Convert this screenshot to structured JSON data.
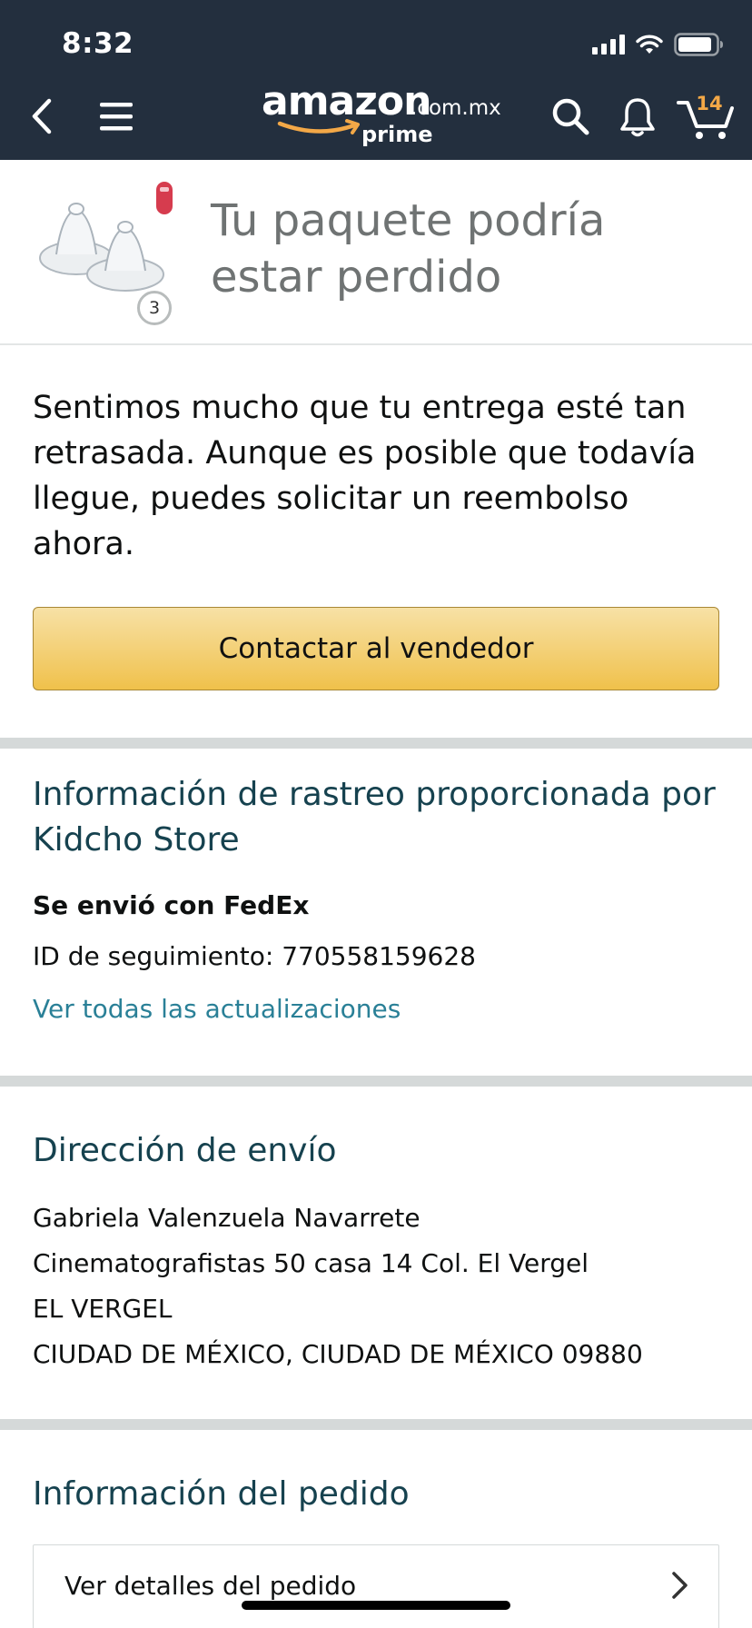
{
  "status_bar": {
    "time": "8:32"
  },
  "header": {
    "logo": {
      "word": "amazon",
      "domain": ".com.mx",
      "tier": "prime"
    },
    "cart_count": "14",
    "colors": {
      "background": "#232f3e",
      "cart_count": "#f3a847"
    },
    "icons": [
      "back-icon",
      "menu-icon",
      "search-icon",
      "bell-icon",
      "cart-icon"
    ]
  },
  "package": {
    "title": "Tu paquete podría estar perdido",
    "quantity": "3"
  },
  "message": {
    "text": "Sentimos mucho que tu entrega esté tan retrasada. Aunque es posible que todavía llegue, puedes solicitar un reembolso ahora.",
    "button_label": "Contactar al vendedor"
  },
  "tracking": {
    "heading": "Información de rastreo proporcionada por Kidcho Store",
    "carrier": "Se envió con FedEx",
    "tracking_id": "ID de seguimiento: 770558159628",
    "updates_link": "Ver todas las actualizaciones"
  },
  "address": {
    "heading": "Dirección de envío",
    "lines": [
      "Gabriela Valenzuela Navarrete",
      "Cinematografistas 50 casa 14 Col. El Vergel",
      "EL VERGEL",
      "CIUDAD DE MÉXICO, CIUDAD DE MÉXICO 09880"
    ]
  },
  "order": {
    "heading": "Información del pedido",
    "details_link": "Ver detalles del pedido"
  }
}
